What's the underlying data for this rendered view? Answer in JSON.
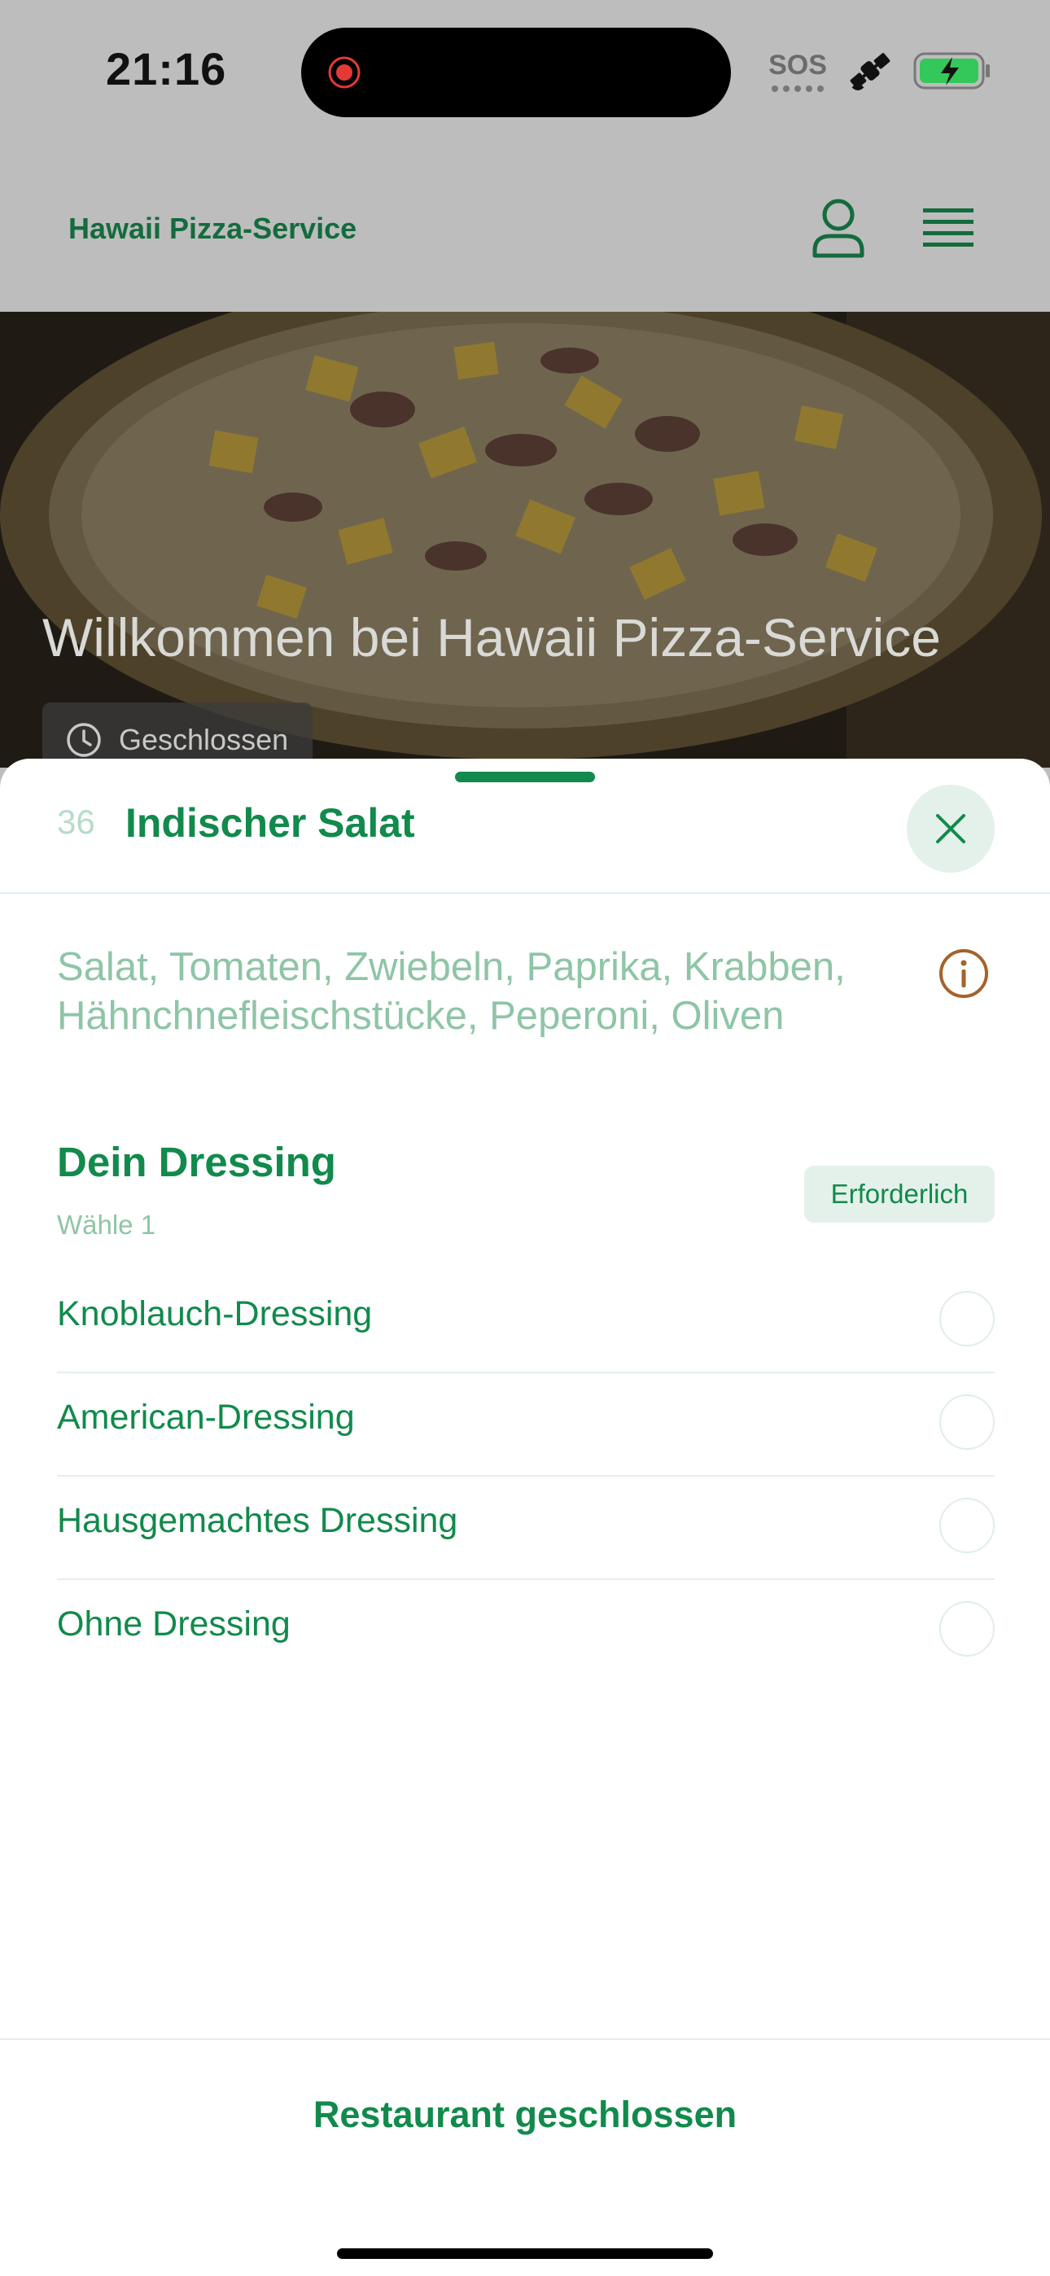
{
  "status_bar": {
    "time": "21:16",
    "sos_label": "SOS"
  },
  "header": {
    "brand": "Hawaii Pizza-Service"
  },
  "hero": {
    "title": "Willkommen bei Hawaii Pizza-Service",
    "status": "Geschlossen"
  },
  "sheet": {
    "item_number": "36",
    "item_title": "Indischer Salat",
    "ingredients_line1": "Salat, Tomaten, Zwiebeln, Paprika, Krabben,",
    "ingredients_line2": "Hähnchnefleischstücke, Peperoni, Oliven",
    "section_title": "Dein Dressing",
    "section_subtitle": "Wähle 1",
    "required_label": "Erforderlich",
    "options": [
      {
        "label": "Knoblauch-Dressing",
        "selected": false
      },
      {
        "label": "American-Dressing",
        "selected": false
      },
      {
        "label": "Hausgemachtes Dressing",
        "selected": false
      },
      {
        "label": "Ohne Dressing",
        "selected": false
      }
    ],
    "footer_button": "Restaurant geschlossen"
  },
  "colors": {
    "brand_green": "#118a4c",
    "light_green_text": "#8ec5a6",
    "info_icon": "#a5622a"
  }
}
